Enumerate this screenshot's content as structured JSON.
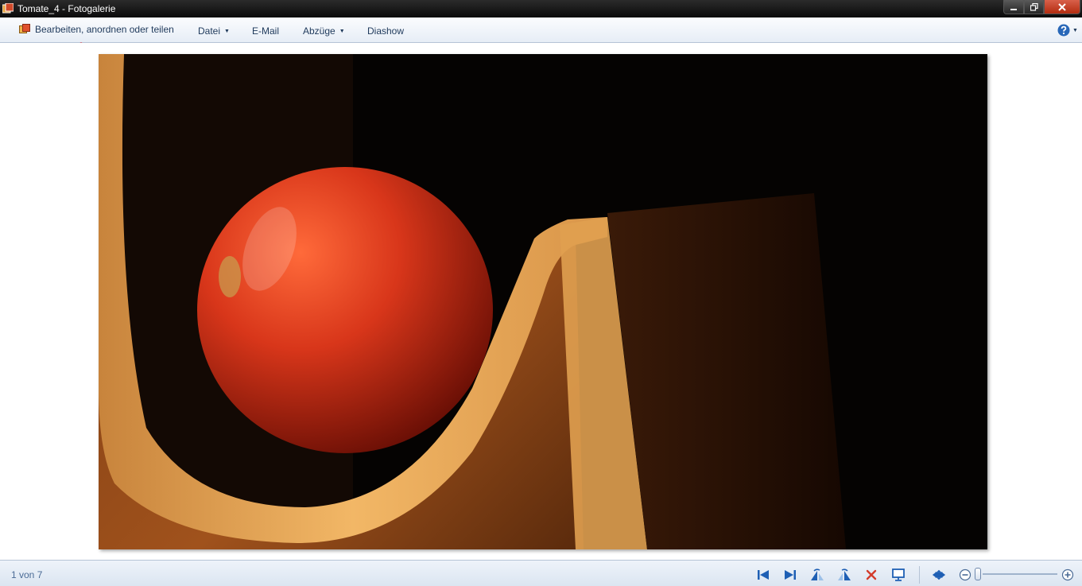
{
  "window": {
    "title": "Tomate_4 - Fotogalerie"
  },
  "menu": {
    "edit_share": "Bearbeiten, anordnen oder teilen",
    "file": "Datei",
    "email": "E-Mail",
    "prints": "Abzüge",
    "slideshow": "Diashow"
  },
  "status": {
    "counter": "1 von 7"
  },
  "icons": {
    "app": "photo-gallery-icon",
    "help": "help-icon",
    "first": "first-image-icon",
    "next": "next-image-icon",
    "rotate_left": "rotate-left-icon",
    "rotate_right": "rotate-right-icon",
    "delete": "delete-icon",
    "slideshow": "slideshow-icon",
    "actual_size": "actual-size-icon",
    "zoom_out": "zoom-out-icon",
    "zoom_in": "zoom-in-icon"
  },
  "colors": {
    "accent": "#1e5fb4",
    "delete": "#d33c2c",
    "annotation": "#e8141b"
  }
}
